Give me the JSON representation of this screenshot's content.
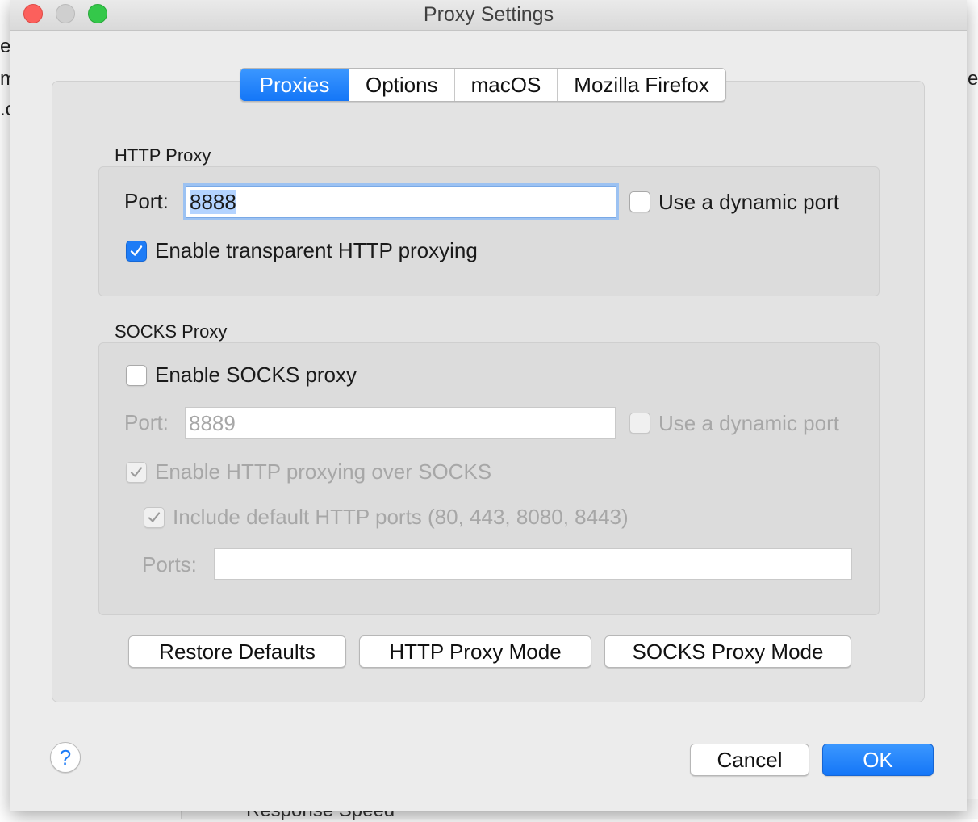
{
  "window": {
    "title": "Proxy Settings"
  },
  "background_fragments": [
    "e.",
    "m",
    ".c",
    "e",
    "Response Speed",
    "-"
  ],
  "tabs": [
    {
      "label": "Proxies",
      "active": true
    },
    {
      "label": "Options",
      "active": false
    },
    {
      "label": "macOS",
      "active": false
    },
    {
      "label": "Mozilla Firefox",
      "active": false
    }
  ],
  "http_proxy": {
    "section_label": "HTTP Proxy",
    "port_label": "Port:",
    "port_value": "8888",
    "dynamic_port_label": "Use a dynamic port",
    "dynamic_port_checked": false,
    "transparent_label": "Enable transparent HTTP proxying",
    "transparent_checked": true
  },
  "socks_proxy": {
    "section_label": "SOCKS Proxy",
    "enable_label": "Enable SOCKS proxy",
    "enable_checked": false,
    "port_label": "Port:",
    "port_placeholder": "8889",
    "dynamic_port_label": "Use a dynamic port",
    "http_over_socks_label": "Enable HTTP proxying over SOCKS",
    "http_over_socks_checked": true,
    "include_ports_label": "Include default HTTP ports (80, 443, 8080, 8443)",
    "include_ports_checked": true,
    "ports_label": "Ports:",
    "ports_value": ""
  },
  "actions": {
    "restore_defaults": "Restore Defaults",
    "http_proxy_mode": "HTTP Proxy Mode",
    "socks_proxy_mode": "SOCKS Proxy Mode"
  },
  "footer": {
    "help_symbol": "?",
    "cancel": "Cancel",
    "ok": "OK"
  },
  "colors": {
    "accent": "#1476f7",
    "window_bg": "#ececec",
    "disabled_text": "#a7a7a7"
  }
}
